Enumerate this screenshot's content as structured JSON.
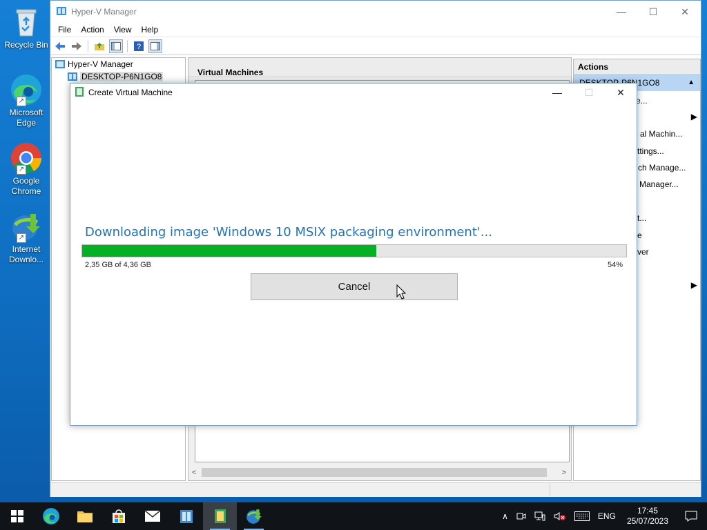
{
  "desktop": {
    "icons": [
      {
        "label": "Recycle Bin",
        "icon": "recycle-bin-icon"
      },
      {
        "label": "Microsoft Edge",
        "icon": "edge-icon"
      },
      {
        "label": "Google Chrome",
        "icon": "chrome-icon"
      },
      {
        "label": "Internet Downlo...",
        "icon": "internet-download-manager-icon"
      }
    ]
  },
  "window": {
    "title": "Hyper-V Manager",
    "menu": [
      "File",
      "Action",
      "View",
      "Help"
    ]
  },
  "tree": {
    "root": "Hyper-V Manager",
    "host": "DESKTOP-P6N1GO8"
  },
  "center": {
    "header": "Virtual Machines"
  },
  "actions": {
    "header": "Actions",
    "host": "DESKTOP-P6N1GO8",
    "items": [
      "e...",
      "al Machin...",
      "ttings...",
      "ch Manage...",
      "Manager...",
      "t...",
      "e",
      "ver"
    ]
  },
  "dialog": {
    "title": "Create Virtual Machine",
    "message": "Downloading image 'Windows 10 MSIX packaging environment'...",
    "size_text": "2,35 GB of 4,36 GB",
    "percent_text": "54%",
    "progress": 0.54,
    "cancel_label": "Cancel"
  },
  "taskbar": {
    "language": "ENG",
    "time": "17:45",
    "date": "25/07/2023"
  },
  "colors": {
    "progress_fill": "#06b025",
    "message_text": "#2473b6",
    "desktop": "#1580d6",
    "selection": "#b8d6f3"
  }
}
